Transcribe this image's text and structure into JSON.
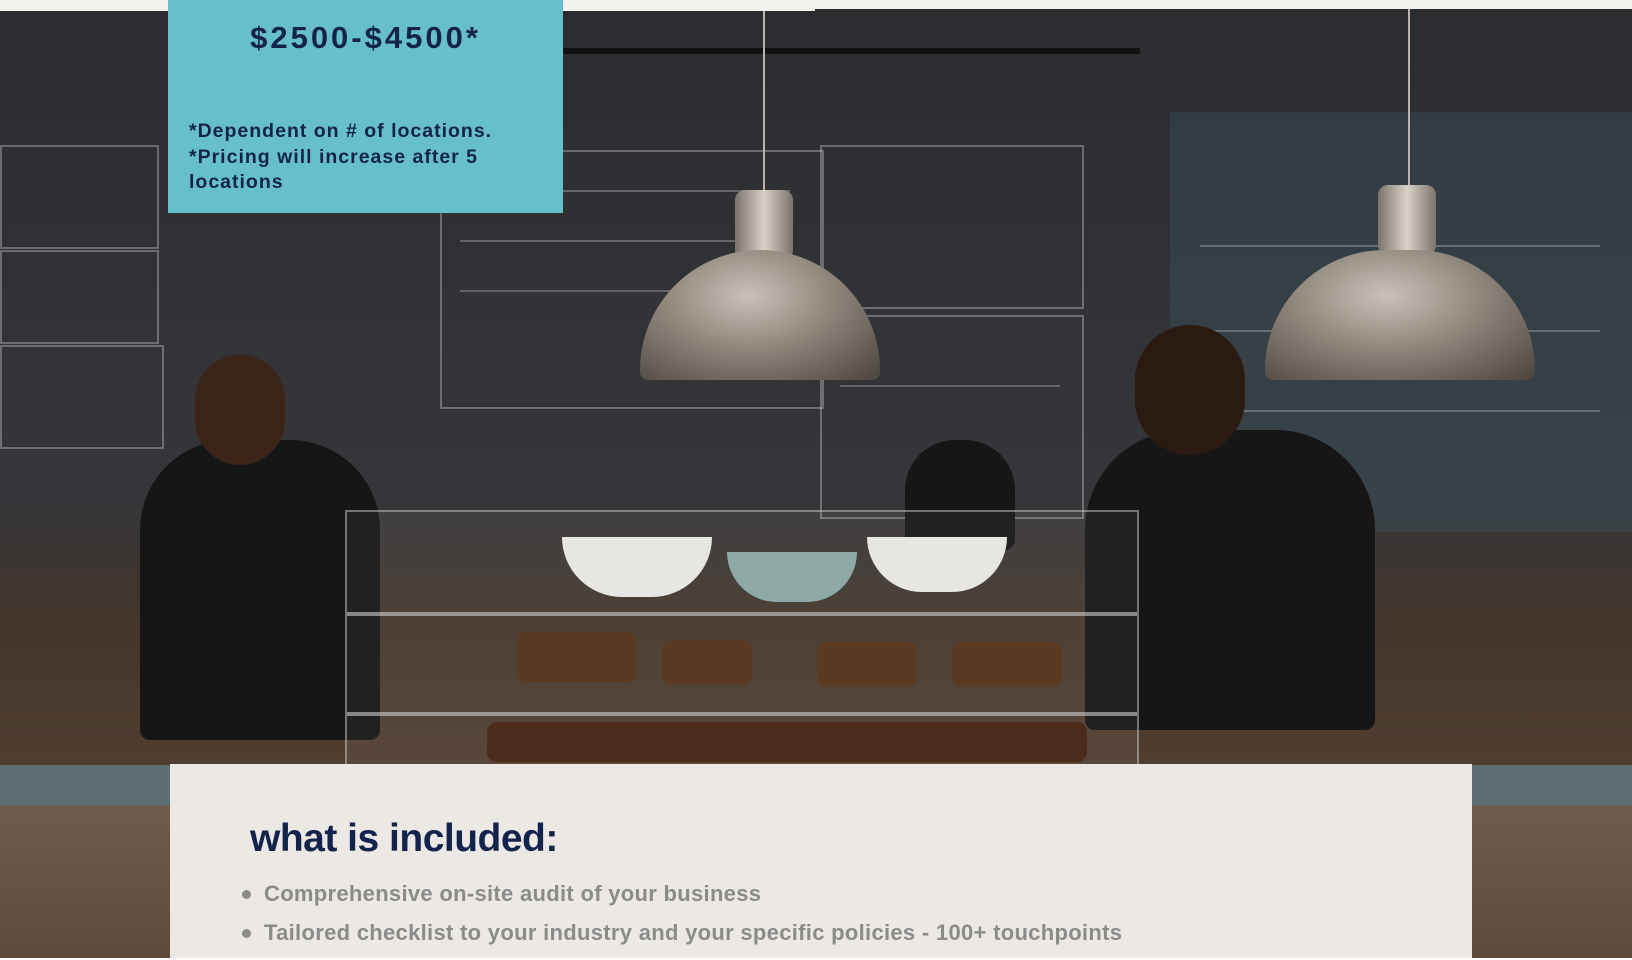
{
  "pricing": {
    "price_range": "$2500-$4500*",
    "notes": [
      "*Dependent on # of locations.",
      "*Pricing will increase after 5",
      "locations"
    ]
  },
  "included": {
    "title": "what is included:",
    "items": [
      "Comprehensive on-site audit of your business",
      "Tailored checklist to your industry and your specific policies - 100+ touchpoints"
    ]
  },
  "hero": {
    "image_description_icon": "cafe-counter-photo"
  },
  "colors": {
    "price_box_bg": "#67bfcb",
    "navy_text": "#14234b",
    "panel_bg": "#ece9e4",
    "list_text": "#8b8b8b"
  }
}
